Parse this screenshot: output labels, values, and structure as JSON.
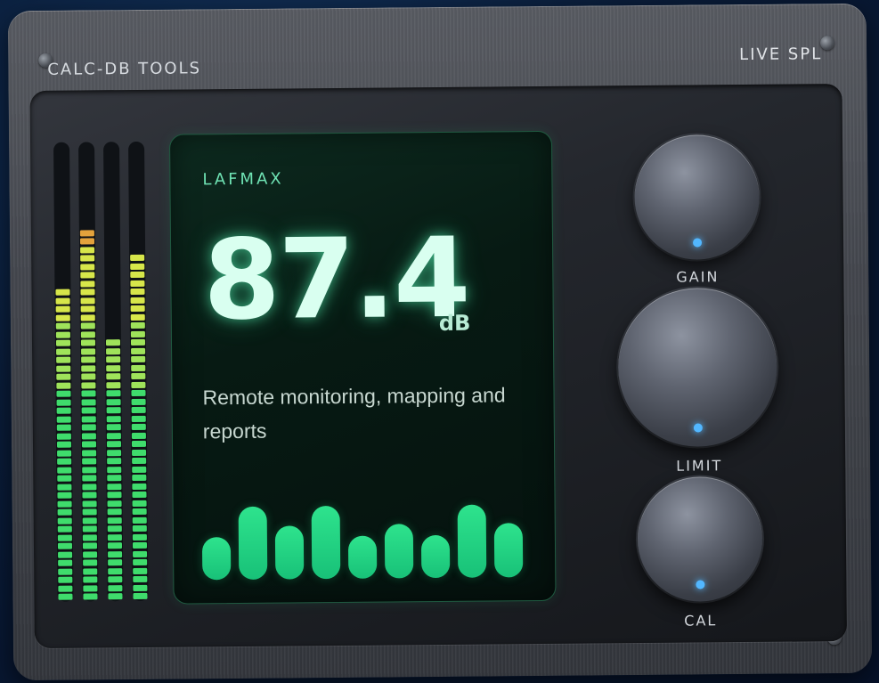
{
  "header": {
    "brand": "CALC-DB TOOLS",
    "mode": "LIVE SPL"
  },
  "display": {
    "label": "LAFMAX",
    "value": "87.4",
    "unit": "dB",
    "description": "Remote monitoring, mapping and reports"
  },
  "meters": {
    "levels": [
      0.68,
      0.82,
      0.58,
      0.75
    ],
    "colors": {
      "low": "#3fdc6c",
      "mid": "#d7e64a",
      "high": "#e3a23c"
    }
  },
  "spectrum": {
    "levels": [
      0.42,
      0.8,
      0.56,
      0.8,
      0.42,
      0.57,
      0.42,
      0.8,
      0.57
    ]
  },
  "knobs": [
    {
      "label": "GAIN"
    },
    {
      "label": "LIMIT"
    },
    {
      "label": "CAL"
    }
  ],
  "colors": {
    "accent": "#52b7ff",
    "screen_glow": "#6fe3b4"
  }
}
